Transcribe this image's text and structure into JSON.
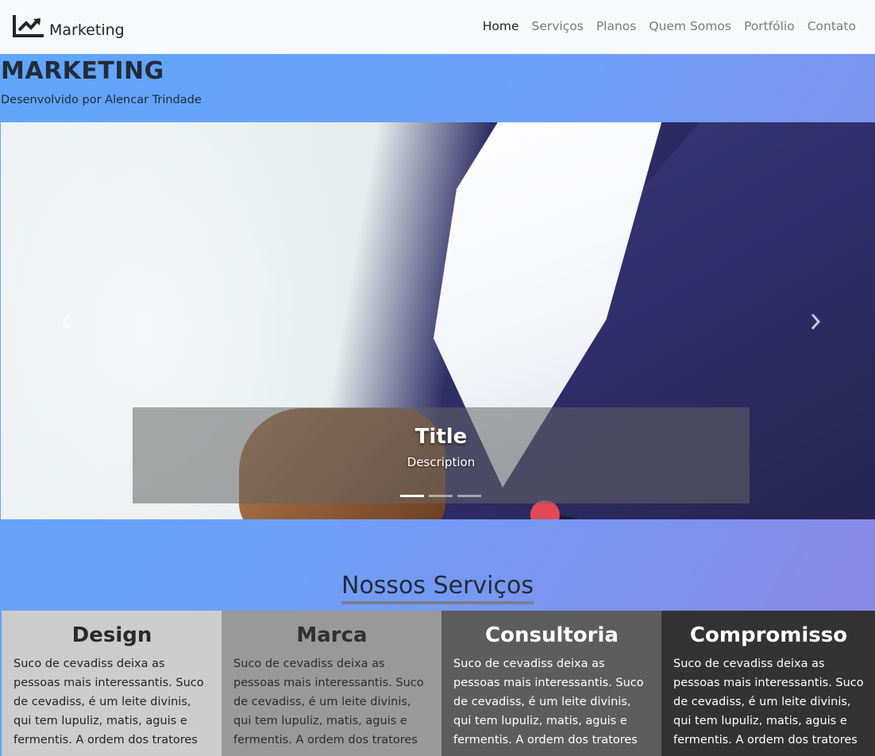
{
  "navbar": {
    "brand": "Marketing",
    "brand_icon": "chart-line-icon",
    "links": [
      {
        "label": "Home",
        "active": true
      },
      {
        "label": "Serviços",
        "active": false
      },
      {
        "label": "Planos",
        "active": false
      },
      {
        "label": "Quem Somos",
        "active": false
      },
      {
        "label": "Portfólio",
        "active": false
      },
      {
        "label": "Contato",
        "active": false
      }
    ]
  },
  "hero": {
    "title": "MARKETING",
    "subtitle": "Desenvolvido por Alencar Trindade"
  },
  "carousel": {
    "caption_title": "Title",
    "caption_description": "Description",
    "prev_icon": "chevron-left-icon",
    "next_icon": "chevron-right-icon",
    "indicator_count": 3,
    "active_index": 0
  },
  "services": {
    "title": "Nossos Serviços",
    "cards": [
      {
        "title": "Design",
        "text": "Suco de cevadiss deixa as pessoas mais interessantis. Suco de cevadiss, é um leite divinis, qui tem lupuliz, matis, aguis e fermentis. A ordem dos tratores"
      },
      {
        "title": "Marca",
        "text": "Suco de cevadiss deixa as pessoas mais interessantis. Suco de cevadiss, é um leite divinis, qui tem lupuliz, matis, aguis e fermentis. A ordem dos tratores"
      },
      {
        "title": "Consultoria",
        "text": "Suco de cevadiss deixa as pessoas mais interessantis. Suco de cevadiss, é um leite divinis, qui tem lupuliz, matis, aguis e fermentis. A ordem dos tratores"
      },
      {
        "title": "Compromisso",
        "text": "Suco de cevadiss deixa as pessoas mais interessantis. Suco de cevadiss, é um leite divinis, qui tem lupuliz, matis, aguis e fermentis. A ordem dos tratores"
      }
    ],
    "card_colors": [
      "#cccccc",
      "#999999",
      "#5d5d5d",
      "#333333"
    ]
  },
  "colors": {
    "gradient_start": "#5fa6fd",
    "gradient_end": "#8b86e2",
    "navbar_bg": "#f8f9fa"
  }
}
